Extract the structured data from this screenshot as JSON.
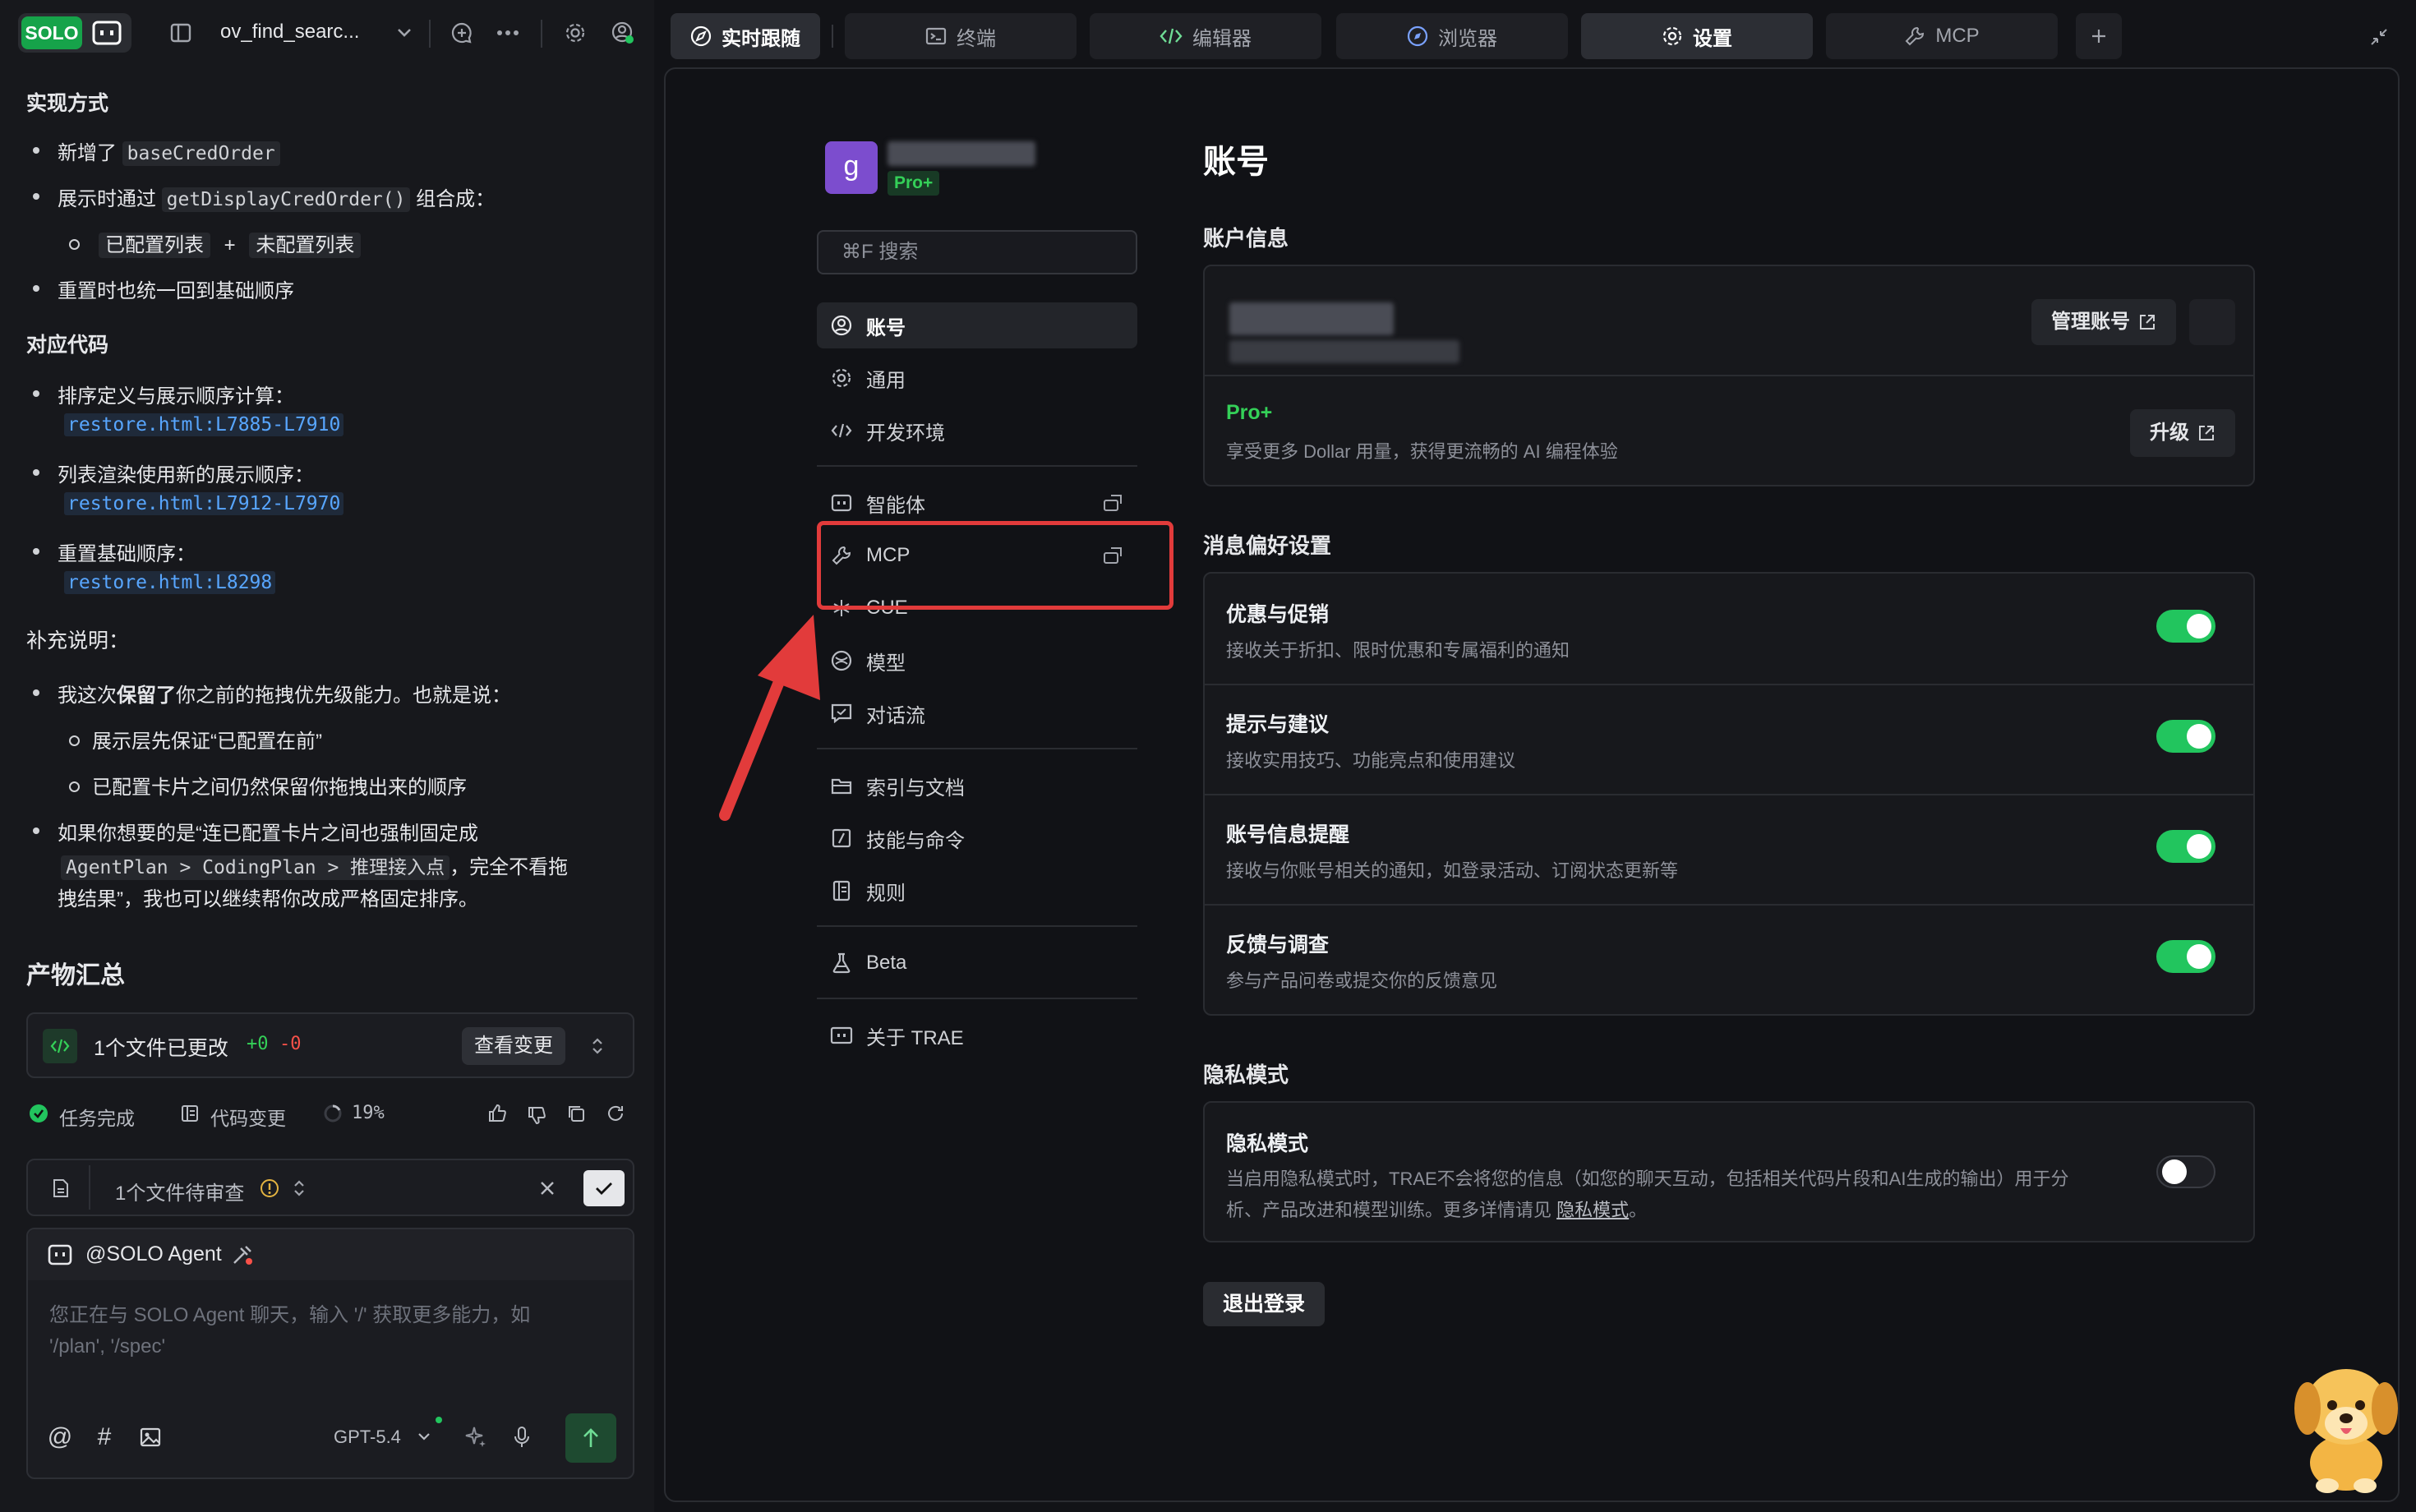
{
  "topbar": {
    "solo_label": "SOLO",
    "project_name": "ov_find_searc..."
  },
  "chat": {
    "impl_heading": "实现方式",
    "impl_b1_prefix": "新增了",
    "impl_b1_code": "baseCredOrder",
    "impl_b2_prefix": "展示时通过",
    "impl_b2_code": "getDisplayCredOrder()",
    "impl_b2_suffix": "组合成：",
    "impl_sub_a": "已配置列表",
    "impl_sub_plus": "+",
    "impl_sub_b": "未配置列表",
    "impl_b3": "重置时也统一回到基础顺序",
    "code_heading": "对应代码",
    "code_b1": "排序定义与展示顺序计算：",
    "code_b1_link": "restore.html:L7885-L7910",
    "code_b2": "列表渲染使用新的展示顺序：",
    "code_b2_link": "restore.html:L7912-L7970",
    "code_b3": "重置基础顺序：",
    "code_b3_link": "restore.html:L8298",
    "note_heading": "补充说明：",
    "note_b1_a": "我这次",
    "note_b1_bold": "保留了",
    "note_b1_b": "你之前的拖拽优先级能力。也就是说：",
    "note_sub1": "展示层先保证“已配置在前”",
    "note_sub2": "已配置卡片之间仍然保留你拖拽出来的顺序",
    "note_b2_line1": "如果你想要的是“连已配置卡片之间也强制固定成",
    "note_b2_code": "AgentPlan > CodingPlan > 推理接入点",
    "note_b2_after": "，完全不看拖",
    "note_b2_line3": "拽结果”，我也可以继续帮你改成严格固定排序。"
  },
  "artifacts": {
    "heading": "产物汇总",
    "changes_label": "1个文件已更改",
    "added": "+0",
    "removed": "-0",
    "view_changes": "查看变更"
  },
  "status": {
    "task_done": "任务完成",
    "code_change": "代码变更",
    "progress": "19%"
  },
  "review": {
    "label": "1个文件待审查"
  },
  "composer": {
    "agent": "@SOLO Agent",
    "placeholder_l1": "您正在与 SOLO Agent 聊天，输入 '/' 获取更多能力，如",
    "placeholder_l2": "'/plan', '/spec'",
    "model": "GPT-5.4"
  },
  "tabs": [
    {
      "label": "实时跟随"
    },
    {
      "label": "终端"
    },
    {
      "label": "编辑器"
    },
    {
      "label": "浏览器"
    },
    {
      "label": "设置"
    },
    {
      "label": "MCP"
    }
  ],
  "settings": {
    "avatar_letter": "g",
    "plan_badge": "Pro+",
    "search_placeholder": "⌘F 搜索",
    "nav": [
      {
        "label": "账号"
      },
      {
        "label": "通用"
      },
      {
        "label": "开发环境"
      },
      {
        "label": "智能体"
      },
      {
        "label": "MCP"
      },
      {
        "label": "CUE"
      },
      {
        "label": "模型"
      },
      {
        "label": "对话流"
      },
      {
        "label": "索引与文档"
      },
      {
        "label": "技能与命令"
      },
      {
        "label": "规则"
      },
      {
        "label": "Beta"
      },
      {
        "label": "关于 TRAE"
      }
    ],
    "page_title": "账号",
    "account_info_title": "账户信息",
    "manage_account": "管理账号",
    "plan_name": "Pro+",
    "plan_desc": "享受更多 Dollar 用量，获得更流畅的 AI 编程体验",
    "upgrade": "升级",
    "msg_pref_title": "消息偏好设置",
    "prefs": [
      {
        "title": "优惠与促销",
        "desc": "接收关于折扣、限时优惠和专属福利的通知",
        "on": true
      },
      {
        "title": "提示与建议",
        "desc": "接收实用技巧、功能亮点和使用建议",
        "on": true
      },
      {
        "title": "账号信息提醒",
        "desc": "接收与你账号相关的通知，如登录活动、订阅状态更新等",
        "on": true
      },
      {
        "title": "反馈与调查",
        "desc": "参与产品问卷或提交你的反馈意见",
        "on": true
      }
    ],
    "privacy_section_title": "隐私模式",
    "privacy_title": "隐私模式",
    "privacy_desc_l1": "当启用隐私模式时，TRAE不会将您的信息（如您的聊天互动，包括相关代码片段和AI生成的输出）用于分",
    "privacy_desc_l2_a": "析、产品改进和模型训练。更多详情请见",
    "privacy_link": "隐私模式",
    "privacy_desc_l2_b": "。",
    "logout": "退出登录"
  },
  "colors": {
    "accent_green": "#22c55e",
    "highlight_red": "#e23b3b",
    "avatar_purple": "#7c4dce"
  }
}
